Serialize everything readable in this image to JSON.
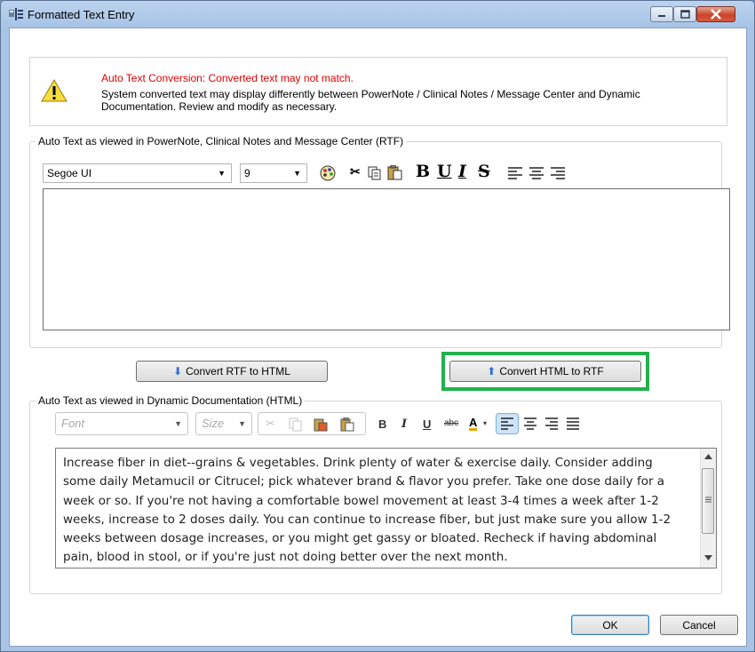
{
  "window": {
    "title": "Formatted Text Entry"
  },
  "warning": {
    "title": "Auto Text Conversion: Converted text may not match.",
    "message": "System converted text may display differently between PowerNote / Clinical Notes / Message Center and Dynamic Documentation. Review and modify as necessary."
  },
  "rtf_section": {
    "legend": "Auto Text as viewed in PowerNote, Clinical Notes and Message Center (RTF)",
    "font": "Segoe UI",
    "size": "9",
    "content": ""
  },
  "buttons": {
    "convert_rtf_to_html": "Convert RTF to HTML",
    "convert_html_to_rtf": "Convert HTML to RTF",
    "ok": "OK",
    "cancel": "Cancel"
  },
  "html_section": {
    "legend": "Auto Text as viewed in Dynamic Documentation (HTML)",
    "font_placeholder": "Font",
    "size_placeholder": "Size",
    "content": "Increase fiber in diet--grains & vegetables. Drink plenty of water & exercise daily. Consider adding some daily Metamucil or Citrucel; pick whatever brand & flavor you prefer. Take one dose daily for a week or so. If you're not having a comfortable bowel movement at least 3-4 times a week after 1-2 weeks, increase to 2 doses daily. You can continue to increase fiber, but just make sure you allow 1-2 weeks between dosage increases, or you might get gassy or bloated. Recheck if having abdominal pain, blood in stool, or if you're just not doing better over the next month."
  },
  "colors": {
    "highlight": "#22b14c",
    "warning_text": "#e10000",
    "window_frame": "#a7c3e6"
  }
}
